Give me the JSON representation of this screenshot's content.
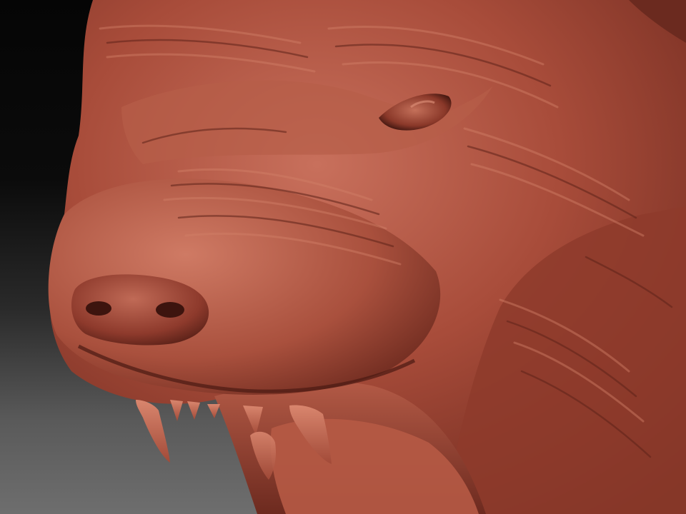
{
  "scene": {
    "subject": "sculpted-wolf-head",
    "colors": {
      "background_top": "#050505",
      "background_bottom": "#6e6e6e",
      "clay_base": "#9c4434",
      "clay_light": "#c8705c",
      "clay_shadow": "#5a2218",
      "teeth": "#c9735e",
      "mouth_interior": "#6a2a20"
    }
  }
}
